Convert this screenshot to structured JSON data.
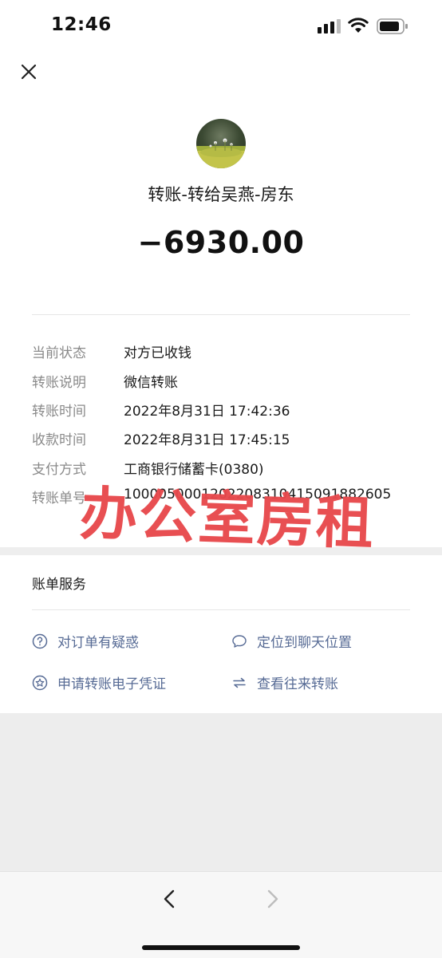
{
  "status_bar": {
    "time": "12:46"
  },
  "header": {
    "close_icon": "close-icon"
  },
  "transfer": {
    "title": "转账-转给吴燕-房东",
    "amount": "−6930.00"
  },
  "details": [
    {
      "label": "当前状态",
      "value": "对方已收钱"
    },
    {
      "label": "转账说明",
      "value": "微信转账"
    },
    {
      "label": "转账时间",
      "value": "2022年8月31日 17:42:36"
    },
    {
      "label": "收款时间",
      "value": "2022年8月31日 17:45:15"
    },
    {
      "label": "支付方式",
      "value": "工商银行储蓄卡(0380)"
    },
    {
      "label": "转账单号",
      "value": "1000050001202208310415091882605"
    }
  ],
  "watermark": "办公室房租",
  "services": {
    "title": "账单服务",
    "items": [
      {
        "label": "对订单有疑惑",
        "icon": "question-circle-icon"
      },
      {
        "label": "定位到聊天位置",
        "icon": "chat-bubble-icon"
      },
      {
        "label": "申请转账电子凭证",
        "icon": "star-badge-icon"
      },
      {
        "label": "查看往来转账",
        "icon": "swap-arrows-icon"
      }
    ]
  },
  "colors": {
    "link": "#576b95",
    "watermark": "#e8484c",
    "background": "#ededed"
  }
}
